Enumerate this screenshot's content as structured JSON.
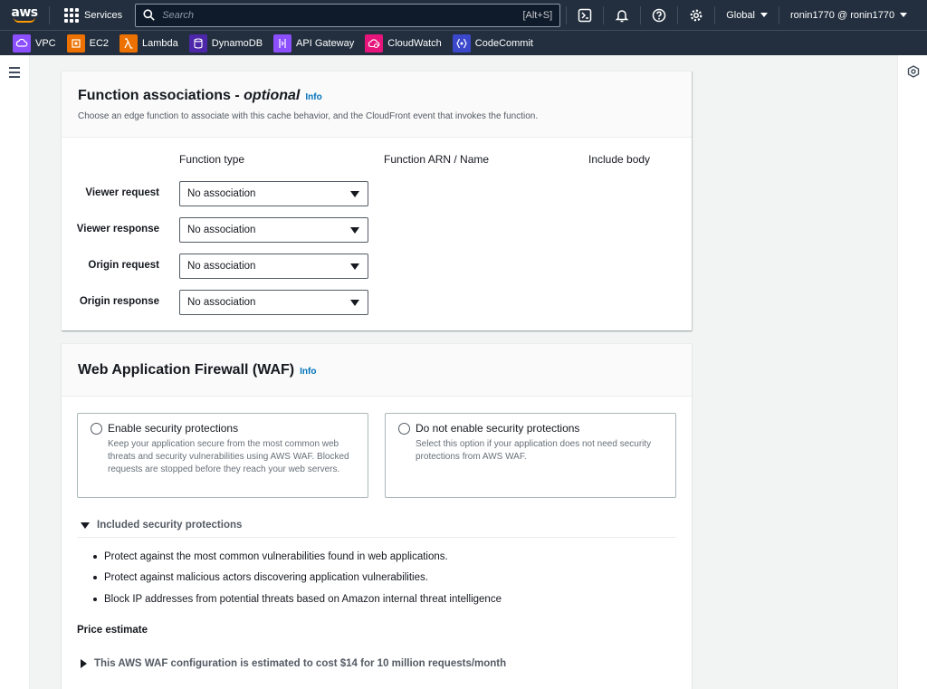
{
  "topnav": {
    "logo_text": "aws",
    "services_label": "Services",
    "search_placeholder": "Search",
    "search_shortcut": "[Alt+S]",
    "region_label": "Global",
    "account_label": "ronin1770 @ ronin1770"
  },
  "favorites": [
    {
      "label": "VPC",
      "color": "#8c4fff",
      "icon": "vpc-icon"
    },
    {
      "label": "EC2",
      "color": "#ed7100",
      "icon": "ec2-icon"
    },
    {
      "label": "Lambda",
      "color": "#ed7100",
      "icon": "lambda-icon"
    },
    {
      "label": "DynamoDB",
      "color": "#4d27aa",
      "icon": "dynamodb-icon"
    },
    {
      "label": "API Gateway",
      "color": "#8c4fff",
      "icon": "api-gateway-icon"
    },
    {
      "label": "CloudWatch",
      "color": "#e7157b",
      "icon": "cloudwatch-icon"
    },
    {
      "label": "CodeCommit",
      "color": "#3b48cc",
      "icon": "codecommit-icon"
    }
  ],
  "function_associations": {
    "title": "Function associations - ",
    "title_optional": "optional",
    "info": "Info",
    "description": "Choose an edge function to associate with this cache behavior, and the CloudFront event that invokes the function.",
    "columns": [
      "Function type",
      "Function ARN / Name",
      "Include body"
    ],
    "rows": [
      {
        "label": "Viewer request",
        "value": "No association"
      },
      {
        "label": "Viewer response",
        "value": "No association"
      },
      {
        "label": "Origin request",
        "value": "No association"
      },
      {
        "label": "Origin response",
        "value": "No association"
      }
    ]
  },
  "waf": {
    "title": "Web Application Firewall (WAF)",
    "info": "Info",
    "options": [
      {
        "title": "Enable security protections",
        "description": "Keep your application secure from the most common web threats and security vulnerabilities using AWS WAF. Blocked requests are stopped before they reach your web servers."
      },
      {
        "title": "Do not enable security protections",
        "description": "Select this option if your application does not need security protections from AWS WAF."
      }
    ],
    "included_label": "Included security protections",
    "protections": [
      "Protect against the most common vulnerabilities found in web applications.",
      "Protect against malicious actors discovering application vulnerabilities.",
      "Block IP addresses from potential threats based on Amazon internal threat intelligence"
    ],
    "price_heading": "Price estimate",
    "price_expander": "This AWS WAF configuration is estimated to cost $14 for 10 million requests/month"
  }
}
